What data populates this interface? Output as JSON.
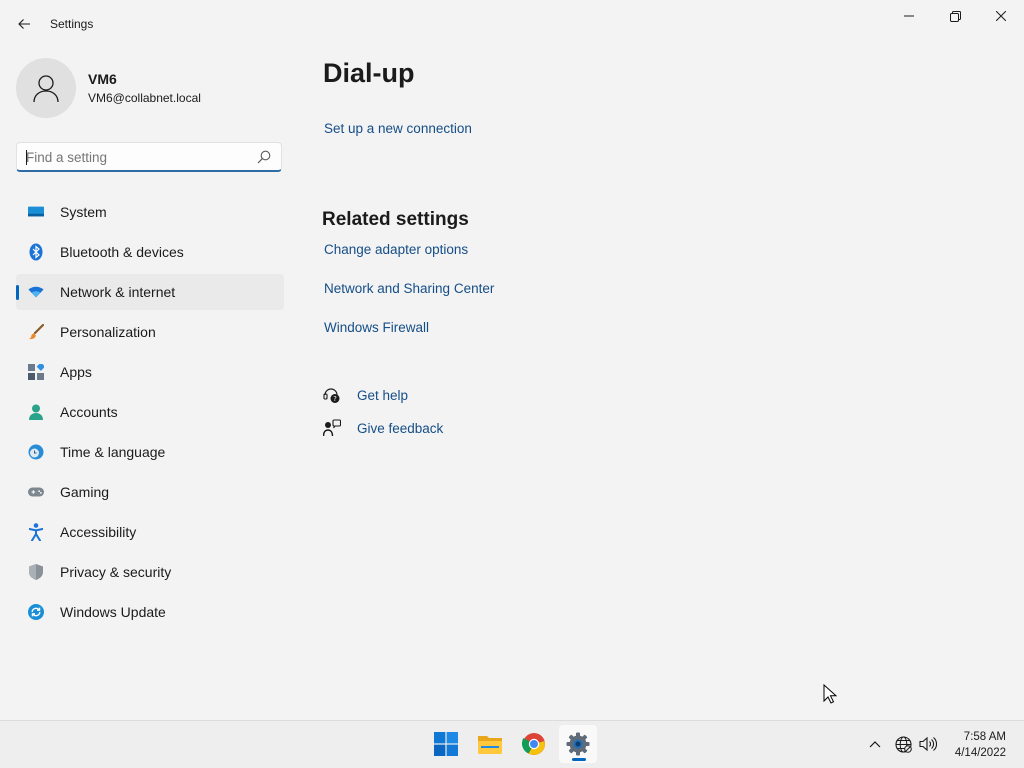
{
  "window": {
    "title": "Settings"
  },
  "profile": {
    "name": "VM6",
    "email": "VM6@collabnet.local"
  },
  "search": {
    "placeholder": "Find a setting",
    "value": ""
  },
  "nav": {
    "items": [
      {
        "label": "System",
        "icon": "monitor-icon",
        "active": false
      },
      {
        "label": "Bluetooth & devices",
        "icon": "bluetooth-icon",
        "active": false
      },
      {
        "label": "Network & internet",
        "icon": "wifi-icon",
        "active": true
      },
      {
        "label": "Personalization",
        "icon": "paintbrush-icon",
        "active": false
      },
      {
        "label": "Apps",
        "icon": "apps-icon",
        "active": false
      },
      {
        "label": "Accounts",
        "icon": "person-icon",
        "active": false
      },
      {
        "label": "Time & language",
        "icon": "globe-clock-icon",
        "active": false
      },
      {
        "label": "Gaming",
        "icon": "gamepad-icon",
        "active": false
      },
      {
        "label": "Accessibility",
        "icon": "accessibility-icon",
        "active": false
      },
      {
        "label": "Privacy & security",
        "icon": "shield-icon",
        "active": false
      },
      {
        "label": "Windows Update",
        "icon": "update-icon",
        "active": false
      }
    ]
  },
  "main": {
    "title": "Dial-up",
    "setup_link": "Set up a new connection",
    "related": {
      "title": "Related settings",
      "links": [
        "Change adapter options",
        "Network and Sharing Center",
        "Windows Firewall"
      ]
    },
    "help": {
      "get_help": "Get help",
      "give_feedback": "Give feedback"
    }
  },
  "taskbar": {
    "apps": [
      "start-icon",
      "file-explorer-icon",
      "chrome-icon",
      "settings-icon"
    ],
    "active_app": "settings-icon",
    "clock": {
      "time": "7:58 AM",
      "date": "4/14/2022"
    }
  },
  "colors": {
    "accent": "#0067c0",
    "link": "#154e87",
    "background": "#f3f3f3"
  }
}
